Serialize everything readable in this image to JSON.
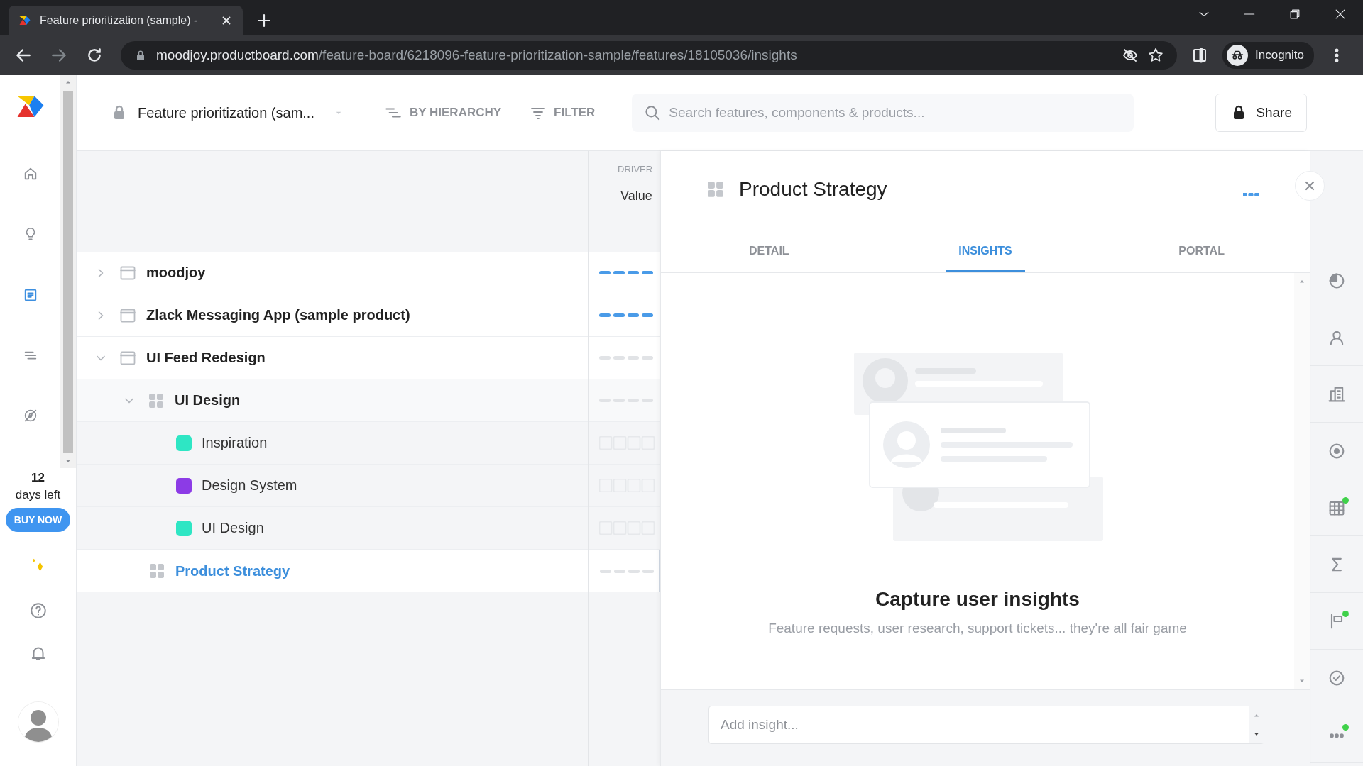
{
  "browser": {
    "tab_title": "Feature prioritization (sample) -",
    "url_host": "moodjoy.productboard.com",
    "url_path": "/feature-board/6218096-feature-prioritization-sample/features/18105036/insights",
    "profile": "Incognito"
  },
  "nav": {
    "items": [
      {
        "selected": false
      },
      {
        "selected": false
      },
      {
        "selected": true
      },
      {
        "selected": false
      },
      {
        "selected": false
      }
    ],
    "trial": {
      "days": "12",
      "label": "days left",
      "button": "BUY NOW"
    }
  },
  "header": {
    "board": "Feature prioritization (sam...",
    "group_by": "BY HIERARCHY",
    "filter": "FILTER",
    "search": {
      "placeholder": "Search features, components & products..."
    },
    "share": "Share"
  },
  "columns": {
    "group": "DRIVER",
    "name": "Value"
  },
  "tree": [
    {
      "label": "moodjoy",
      "kind": "product",
      "expanded": false,
      "selected": false,
      "scored": true
    },
    {
      "label": "Zlack Messaging App (sample product)",
      "kind": "product",
      "expanded": false,
      "selected": false,
      "scored": true
    },
    {
      "label": "UI Feed Redesign",
      "kind": "product",
      "expanded": true,
      "selected": false,
      "scored": false,
      "children": [
        {
          "label": "UI Design",
          "kind": "component",
          "expanded": true,
          "selected": false,
          "scored": false,
          "children": [
            {
              "label": "Inspiration",
              "kind": "feature",
              "color": "#2ee6c4",
              "selected": false
            },
            {
              "label": "Design System",
              "kind": "feature",
              "color": "#8c3be6",
              "selected": false
            },
            {
              "label": "UI Design",
              "kind": "feature",
              "color": "#2ee6c4",
              "selected": false
            }
          ]
        },
        {
          "label": "Product Strategy",
          "kind": "component",
          "selected": true,
          "scored": false
        }
      ]
    }
  ],
  "panel": {
    "title": "Product Strategy",
    "tabs": [
      {
        "label": "DETAIL",
        "selected": false
      },
      {
        "label": "INSIGHTS",
        "selected": true
      },
      {
        "label": "PORTAL",
        "selected": false
      }
    ],
    "empty_title": "Capture user insights",
    "empty_text": "Feature requests, user research, support tickets... they're all fair game",
    "insight": {
      "placeholder": "Add insight..."
    }
  },
  "right_bar": [
    {
      "badge": false
    },
    {
      "badge": false
    },
    {
      "badge": false
    },
    {
      "badge": false
    },
    {
      "badge": true
    },
    {
      "badge": false
    },
    {
      "badge": true
    },
    {
      "badge": false
    },
    {
      "badge": true
    }
  ]
}
